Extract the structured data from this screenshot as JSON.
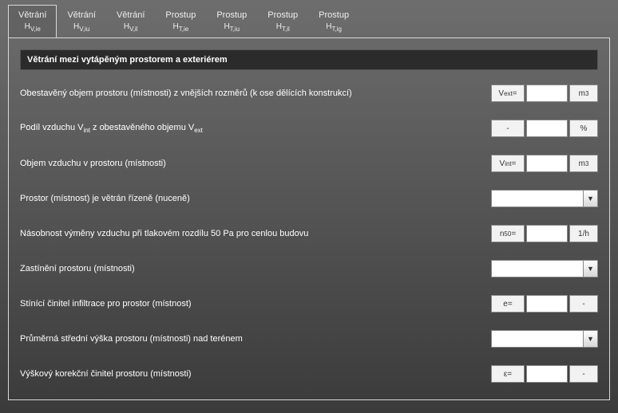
{
  "tabs": [
    {
      "line1": "Větrání",
      "line2_pre": "H",
      "line2_sub": "V,ie"
    },
    {
      "line1": "Větrání",
      "line2_pre": "H",
      "line2_sub": "V,iu"
    },
    {
      "line1": "Větrání",
      "line2_pre": "H",
      "line2_sub": "V,il"
    },
    {
      "line1": "Prostup",
      "line2_pre": "H",
      "line2_sub": "T,ie"
    },
    {
      "line1": "Prostup",
      "line2_pre": "H",
      "line2_sub": "T,iu"
    },
    {
      "line1": "Prostup",
      "line2_pre": "H",
      "line2_sub": "T,il"
    },
    {
      "line1": "Prostup",
      "line2_pre": "H",
      "line2_sub": "T,ig"
    }
  ],
  "active_tab": 0,
  "section_title": "Větrání mezi vytápěným prostorem a exteriérem",
  "rows": [
    {
      "label_html": "Obestavěný objem prostoru (místnosti) z vnějších rozměrů (k ose dělících konstrukcí)",
      "kind": "lvu",
      "lbl_html": "V<sub>ext</sub>=",
      "unit_html": "m<sup>3</sup>"
    },
    {
      "label_html": "Podíl vzduchu V<sub>int</sub> z obestavěného objemu V<sub>ext</sub>",
      "kind": "lvu",
      "lbl_html": "-",
      "unit_html": "%"
    },
    {
      "label_html": "Objem vzduchu v prostoru (místnosti)",
      "kind": "lvu",
      "lbl_html": "V<sub>int</sub>=",
      "unit_html": "m<sup>3</sup>"
    },
    {
      "label_html": "Prostor (místnost) je větrán řízeně (nuceně)",
      "kind": "select"
    },
    {
      "label_html": "Násobnost výměny vzduchu při tlakovém rozdílu 50 Pa pro cenlou budovu",
      "kind": "lvu",
      "lbl_html": "n<sub>50</sub>=",
      "unit_html": "1/h"
    },
    {
      "label_html": "Zastínění prostoru (místnosti)",
      "kind": "select"
    },
    {
      "label_html": "Stínící činitel infiltrace pro prostor (místnost)",
      "kind": "lvu",
      "lbl_html": "e=",
      "unit_html": "-"
    },
    {
      "label_html": "Průměrná střední výška prostoru (místnosti) nad terénem",
      "kind": "select"
    },
    {
      "label_html": "Výškový korekční činitel prostoru (místnosti)",
      "kind": "lvu",
      "lbl_html": "ε=",
      "unit_html": "-"
    }
  ]
}
